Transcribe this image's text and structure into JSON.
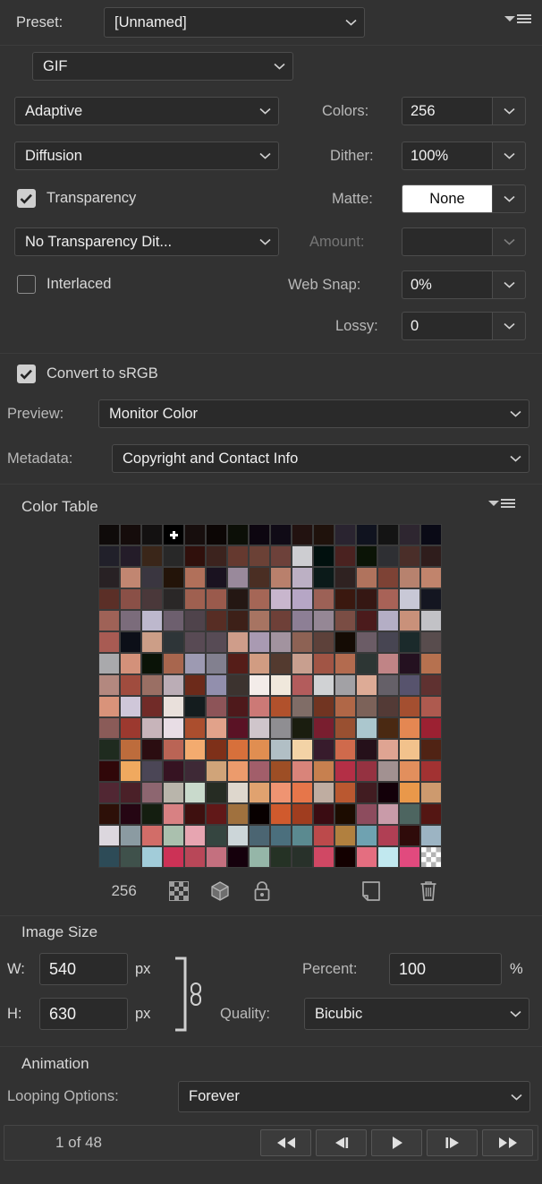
{
  "panel": {
    "flyout_icon": "panel-menu-icon"
  },
  "preset": {
    "label": "Preset:",
    "value": "[Unnamed]"
  },
  "format": {
    "value": "GIF"
  },
  "settings": {
    "reduction_algorithm": "Adaptive",
    "colors_label": "Colors:",
    "colors_value": "256",
    "dither_algorithm": "Diffusion",
    "dither_label": "Dither:",
    "dither_value": "100%",
    "transparency_label": "Transparency",
    "transparency_checked": true,
    "matte_label": "Matte:",
    "matte_value": "None",
    "transparency_dither": "No Transparency Dit...",
    "amount_label": "Amount:",
    "amount_value": "",
    "interlaced_label": "Interlaced",
    "interlaced_checked": false,
    "websnap_label": "Web Snap:",
    "websnap_value": "0%",
    "lossy_label": "Lossy:",
    "lossy_value": "0"
  },
  "color_mgmt": {
    "convert_srgb_label": "Convert to sRGB",
    "convert_srgb_checked": true,
    "preview_label": "Preview:",
    "preview_value": "Monitor Color",
    "metadata_label": "Metadata:",
    "metadata_value": "Copyright and Contact Info"
  },
  "color_table": {
    "title": "Color Table",
    "count": "256",
    "toolbar_icons": [
      "transparency-icon",
      "web-shift-cube-icon",
      "lock-icon",
      "new-color-icon",
      "delete-color-icon"
    ],
    "selected_index": 3,
    "alpha_index": 255,
    "swatches": [
      "#0f0b0a",
      "#150c0b",
      "#131111",
      "#000000",
      "#170e0d",
      "#0c0605",
      "#0c0f07",
      "#0d0610",
      "#100b16",
      "#221210",
      "#1f120c",
      "#2a2430",
      "#10131f",
      "#141414",
      "#2e2630",
      "#0a0a16",
      "#21202a",
      "#241c29",
      "#3a2619",
      "#282828",
      "#30100c",
      "#3c231e",
      "#65392f",
      "#6b4136",
      "#6d413a",
      "#cdcdd1",
      "#01100e",
      "#4a2220",
      "#0b1406",
      "#2e2f33",
      "#4a2e29",
      "#2f1d1c",
      "#282124",
      "#c18671",
      "#3a3640",
      "#231409",
      "#b1705a",
      "#1a1220",
      "#99899b",
      "#4a2e23",
      "#b9806c",
      "#bcb0c4",
      "#0b1a19",
      "#2f2221",
      "#b0735d",
      "#7d4235",
      "#b7826e",
      "#c1846c",
      "#5b2f27",
      "#8a5047",
      "#4a383a",
      "#2a2727",
      "#9f6050",
      "#9a5a4c",
      "#241713",
      "#a56656",
      "#c8b6cd",
      "#b6a6c5",
      "#9c6156",
      "#3a180f",
      "#351713",
      "#a86257",
      "#c8c8d6",
      "#141621",
      "#9f6257",
      "#7b6c7b",
      "#bdb8cd",
      "#6d5f6e",
      "#4f434b",
      "#572d24",
      "#3d2018",
      "#a77462",
      "#6e4038",
      "#8d7f95",
      "#958795",
      "#7a4d44",
      "#4b1b1c",
      "#b4aec5",
      "#c9917a",
      "#c2c2c6",
      "#a85b53",
      "#0c0f18",
      "#cc9e87",
      "#2e3538",
      "#584a54",
      "#574b55",
      "#cf9d8a",
      "#a99ab2",
      "#a2939f",
      "#8d6254",
      "#5d413a",
      "#140b04",
      "#6b5c66",
      "#474552",
      "#1b2a2b",
      "#584c4d",
      "#a9a9ac",
      "#d3917a",
      "#0a1307",
      "#a8664e",
      "#9d9ab2",
      "#82808f",
      "#551d18",
      "#d19c82",
      "#533a2f",
      "#c89f8f",
      "#a15545",
      "#b36b4f",
      "#2d3634",
      "#c08486",
      "#241120",
      "#b6714f",
      "#b3887f",
      "#a04c3e",
      "#9a6f64",
      "#bbadb6",
      "#6c2a1a",
      "#928fad",
      "#3c332f",
      "#f3ece9",
      "#f0e8dc",
      "#b35c5c",
      "#d0d2d4",
      "#a2a1a5",
      "#ddab96",
      "#656068",
      "#57536d",
      "#5f3130",
      "#d9937a",
      "#cfc7d9",
      "#712b28",
      "#e9e0db",
      "#141c1e",
      "#8d5458",
      "#4e191b",
      "#cc7976",
      "#b1512c",
      "#806d67",
      "#713421",
      "#b06747",
      "#7c6259",
      "#533a36",
      "#a44f30",
      "#ae5a4f",
      "#8a5b58",
      "#9c392f",
      "#c7b4ba",
      "#e8dde5",
      "#ab4e2e",
      "#e1a28a",
      "#5a1225",
      "#cfc5cb",
      "#8f8e92",
      "#1a1d0f",
      "#791e2f",
      "#995031",
      "#abc7ce",
      "#4a2912",
      "#e48752",
      "#9c2132",
      "#1f2b1f",
      "#bd6c3c",
      "#2b0d11",
      "#ba6455",
      "#f3ab6f",
      "#7e3019",
      "#d7703b",
      "#e08e51",
      "#b1bfc5",
      "#f3d3a6",
      "#371b2c",
      "#cf6a4c",
      "#25101a",
      "#dfa492",
      "#f2c28c",
      "#502314",
      "#300709",
      "#f0a95f",
      "#4b4656",
      "#361322",
      "#3e2936",
      "#d0a479",
      "#ec9b6c",
      "#a25e6a",
      "#9d4e25",
      "#d9847a",
      "#c7804f",
      "#b42f46",
      "#953241",
      "#a29191",
      "#e28f5d",
      "#a23232",
      "#512733",
      "#4a2028",
      "#8d6670",
      "#b9b5ab",
      "#c9dacc",
      "#262c23",
      "#ded7cd",
      "#e0a26f",
      "#ef9472",
      "#e6764a",
      "#bfada1",
      "#ba5830",
      "#411c21",
      "#130009",
      "#e9984a",
      "#cd9a6e",
      "#2d1008",
      "#250613",
      "#141e10",
      "#d88183",
      "#3e100f",
      "#611818",
      "#a0713e",
      "#080000",
      "#d05a2d",
      "#a03d1f",
      "#3a0c12",
      "#1c0c00",
      "#8d4c5e",
      "#c99ba9",
      "#4d6560",
      "#541613",
      "#dcd7de",
      "#8b9ba2",
      "#d26d68",
      "#aac0ae",
      "#e7a5b1",
      "#354540",
      "#ccd6d9",
      "#4b6572",
      "#4b6f7d",
      "#5b8a90",
      "#bc4a4b",
      "#b1803f",
      "#6fa2b1",
      "#b03f54",
      "#2f0b0a",
      "#9cb4c3",
      "#2d4b57",
      "#3f514b",
      "#a2ccd9",
      "#cc3256",
      "#b84758",
      "#c4707f",
      "#15000c",
      "#95b6a8",
      "#253225",
      "#28312a",
      "#d04864",
      "#130000",
      "#e46e80",
      "#c1e8ef",
      "#e14a7e",
      "#ffffff"
    ]
  },
  "image_size": {
    "title": "Image Size",
    "w_label": "W:",
    "w_value": "540",
    "w_unit": "px",
    "h_label": "H:",
    "h_value": "630",
    "h_unit": "px",
    "link_icon": "chain-link-icon",
    "percent_label": "Percent:",
    "percent_value": "100",
    "percent_unit": "%",
    "quality_label": "Quality:",
    "quality_value": "Bicubic"
  },
  "animation": {
    "title": "Animation",
    "looping_label": "Looping Options:",
    "looping_value": "Forever",
    "frame_count": "1 of 48",
    "controls": [
      "rewind-to-start-button",
      "step-backward-button",
      "play-button",
      "step-forward-button",
      "forward-to-end-button"
    ]
  },
  "colors": {
    "panel_bg": "#323232",
    "field_bg": "#2a2a2a",
    "border": "#4c4c4c",
    "text": "#d6d6d6",
    "dim_text": "#767676"
  }
}
